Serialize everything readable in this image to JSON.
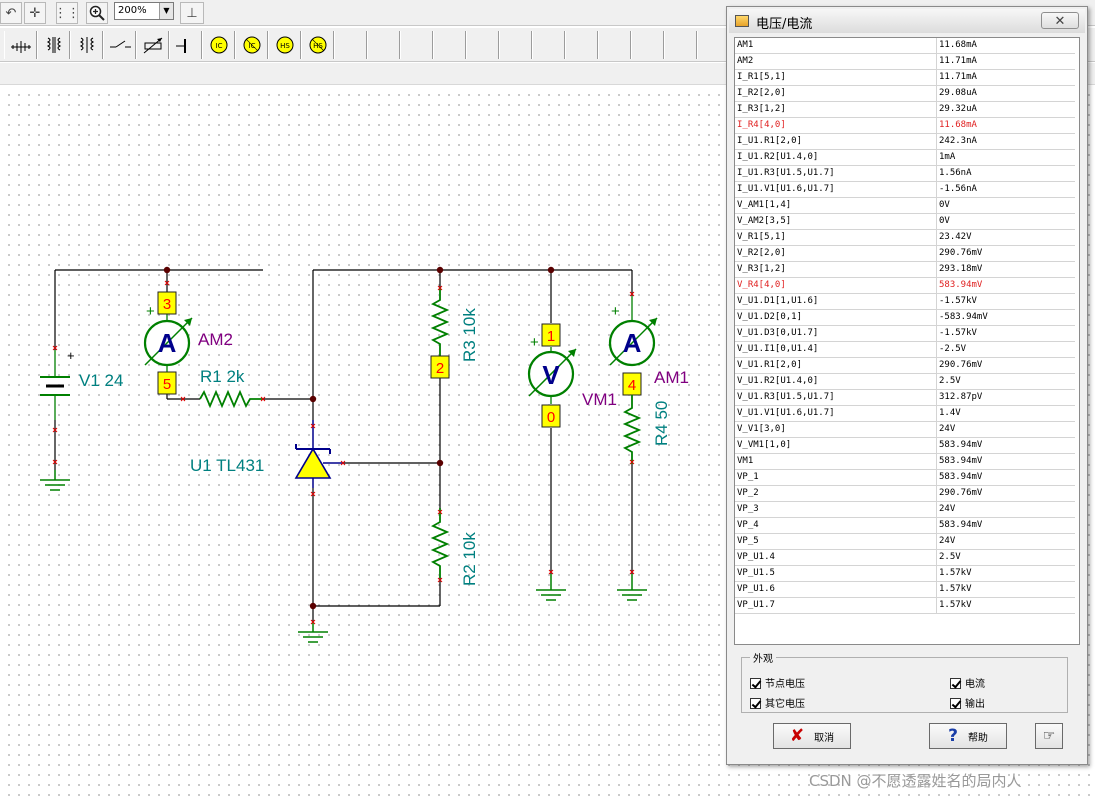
{
  "toolbar": {
    "zoom_value": "200%",
    "zoom_icon": "magnifier-plus-icon",
    "components": [
      "ground-icon",
      "transformer-icon",
      "transformer2-icon",
      "switch-icon",
      "potentiometer-icon",
      "capacitor-icon",
      "ic-icon",
      "ic2-icon",
      "hs-icon",
      "hs2-icon"
    ]
  },
  "circuit": {
    "labels": {
      "v1": "V1 24",
      "am2": "AM2",
      "r1": "R1 2k",
      "u1": "U1 TL431",
      "r3": "R3 10k",
      "r2": "R2 10k",
      "vm1": "VM1",
      "am1": "AM1",
      "r4": "R4 50",
      "ammeter_symbol": "A",
      "voltmeter_symbol": "V",
      "plus": "+"
    },
    "nodes": {
      "n3": "3",
      "n5": "5",
      "n2": "2",
      "n1": "1",
      "n0": "0",
      "n4": "4"
    },
    "colors": {
      "wire": "#000000",
      "component": "#008000",
      "component_label": "#008080",
      "meter_label": "#800080",
      "node_box": "#ffff00",
      "node_text": "#ff0000",
      "meter_letter": "#00008b",
      "zener_fill": "#ffff00",
      "zener_stroke": "#00008b"
    }
  },
  "dialog": {
    "title": "电压/电流",
    "close_label": "✕",
    "rows": [
      {
        "name": "AM1",
        "value": "11.68mA"
      },
      {
        "name": "AM2",
        "value": "11.71mA"
      },
      {
        "name": "I_R1[5,1]",
        "value": "11.71mA"
      },
      {
        "name": "I_R2[2,0]",
        "value": "29.08uA"
      },
      {
        "name": "I_R3[1,2]",
        "value": "29.32uA"
      },
      {
        "name": "I_R4[4,0]",
        "value": "11.68mA"
      },
      {
        "name": "I_U1.R1[2,0]",
        "value": "242.3nA"
      },
      {
        "name": "I_U1.R2[U1.4,0]",
        "value": "1mA"
      },
      {
        "name": "I_U1.R3[U1.5,U1.7]",
        "value": "1.56nA"
      },
      {
        "name": "I_U1.V1[U1.6,U1.7]",
        "value": "-1.56nA"
      },
      {
        "name": "V_AM1[1,4]",
        "value": "0V"
      },
      {
        "name": "V_AM2[3,5]",
        "value": "0V"
      },
      {
        "name": "V_R1[5,1]",
        "value": "23.42V"
      },
      {
        "name": "V_R2[2,0]",
        "value": "290.76mV"
      },
      {
        "name": "V_R3[1,2]",
        "value": "293.18mV"
      },
      {
        "name": "V_R4[4,0]",
        "value": "583.94mV"
      },
      {
        "name": "V_U1.D1[1,U1.6]",
        "value": "-1.57kV"
      },
      {
        "name": "V_U1.D2[0,1]",
        "value": "-583.94mV"
      },
      {
        "name": "V_U1.D3[0,U1.7]",
        "value": "-1.57kV"
      },
      {
        "name": "V_U1.I1[0,U1.4]",
        "value": "-2.5V"
      },
      {
        "name": "V_U1.R1[2,0]",
        "value": "290.76mV"
      },
      {
        "name": "V_U1.R2[U1.4,0]",
        "value": "2.5V"
      },
      {
        "name": "V_U1.R3[U1.5,U1.7]",
        "value": "312.87pV"
      },
      {
        "name": "V_U1.V1[U1.6,U1.7]",
        "value": "1.4V"
      },
      {
        "name": "V_V1[3,0]",
        "value": "24V"
      },
      {
        "name": "V_VM1[1,0]",
        "value": "583.94mV"
      },
      {
        "name": "VM1",
        "value": "583.94mV"
      },
      {
        "name": "VP_1",
        "value": "583.94mV"
      },
      {
        "name": "VP_2",
        "value": "290.76mV"
      },
      {
        "name": "VP_3",
        "value": "24V"
      },
      {
        "name": "VP_4",
        "value": "583.94mV"
      },
      {
        "name": "VP_5",
        "value": "24V"
      },
      {
        "name": "VP_U1.4",
        "value": "2.5V"
      },
      {
        "name": "VP_U1.5",
        "value": "1.57kV"
      },
      {
        "name": "VP_U1.6",
        "value": "1.57kV"
      },
      {
        "name": "VP_U1.7",
        "value": "1.57kV"
      }
    ],
    "highlight_color": "#e02020",
    "group": {
      "legend": "外观",
      "node_voltage": "节点电压",
      "current": "电流",
      "other_voltage": "其它电压",
      "output": "输出"
    },
    "buttons": {
      "cancel": "取消",
      "help": "帮助",
      "cancel_icon": "red-x-icon",
      "help_icon": "question-icon",
      "pointer_icon": "hand-pointer-icon"
    }
  },
  "watermark": "CSDN @不愿透露姓名的局内人"
}
